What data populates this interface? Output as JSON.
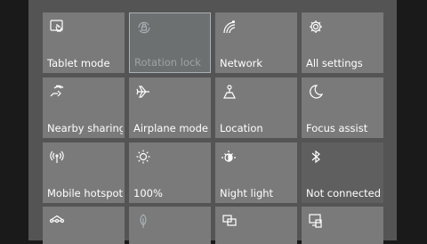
{
  "quick_actions": [
    {
      "label": "Tablet mode",
      "icon": "tablet-mode-icon",
      "state": "off"
    },
    {
      "label": "Rotation lock",
      "icon": "rotation-lock-icon",
      "state": "disabled"
    },
    {
      "label": "Network",
      "icon": "network-icon",
      "state": "off"
    },
    {
      "label": "All settings",
      "icon": "settings-gear-icon",
      "state": "off"
    },
    {
      "label": "Nearby sharing",
      "icon": "nearby-sharing-icon",
      "state": "off"
    },
    {
      "label": "Airplane mode",
      "icon": "airplane-icon",
      "state": "off"
    },
    {
      "label": "Location",
      "icon": "location-icon",
      "state": "off"
    },
    {
      "label": "Focus assist",
      "icon": "moon-icon",
      "state": "off"
    },
    {
      "label": "Mobile hotspot",
      "icon": "hotspot-icon",
      "state": "off"
    },
    {
      "label": "100%",
      "icon": "brightness-icon",
      "state": "off"
    },
    {
      "label": "Night light",
      "icon": "night-light-icon",
      "state": "off"
    },
    {
      "label": "Not connected",
      "icon": "bluetooth-icon",
      "state": "dark"
    },
    {
      "label": "",
      "icon": "vpn-icon",
      "state": "partial"
    },
    {
      "label": "",
      "icon": "battery-saver-leaf-icon",
      "state": "partial"
    },
    {
      "label": "",
      "icon": "project-icon",
      "state": "partial"
    },
    {
      "label": "",
      "icon": "connect-icon",
      "state": "partial"
    }
  ],
  "colors": {
    "tile": "#7a7a7a",
    "tile_disabled": "#6c7071",
    "panel": "#545454",
    "text": "#ffffff"
  }
}
